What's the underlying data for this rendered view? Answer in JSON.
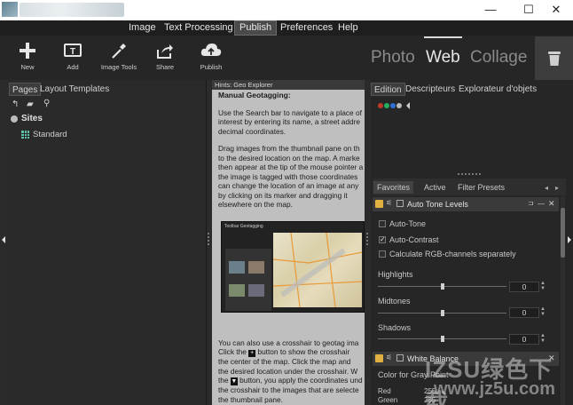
{
  "window": {
    "minimize_glyph": "—",
    "maximize_glyph": "☐",
    "close_glyph": "✕"
  },
  "menu": {
    "items": [
      "Image",
      "Text Processing",
      "Publish",
      "Preferences",
      "Help"
    ],
    "active": "Publish"
  },
  "toolbar": {
    "tools": [
      {
        "label": "New",
        "icon": "plus-icon"
      },
      {
        "label": "Add",
        "icon": "add-text-icon"
      },
      {
        "label": "Image Tools",
        "icon": "pipette-icon"
      },
      {
        "label": "Share",
        "icon": "share-icon"
      },
      {
        "label": "Publish",
        "icon": "cloud-upload-icon"
      }
    ],
    "modes": [
      "Photo",
      "Web",
      "Collage"
    ],
    "active_mode": "Web"
  },
  "left_panel": {
    "tabs": [
      "Pages",
      "Layout Templates"
    ],
    "active_tab": "Pages",
    "tree": {
      "root": "Sites",
      "child": "Standard"
    }
  },
  "hints": {
    "title": "Hints: Geo Explorer",
    "heading": "Manual Geotagging:",
    "para1": [
      "Use the Search bar to navigate to a place of",
      "interest by entering its name, a street addre",
      "decimal coordinates."
    ],
    "para2": [
      "Drag images from the thumbnail pane on th",
      "to the desired location on the map. A marke",
      "then appear at the tip of the mouse pointer a",
      "the image is tagged with those coordinates",
      "can change the location of an image at any",
      "by clicking on its marker and dragging it",
      "elsewhere on the map."
    ],
    "para3": [
      "You can also use a crosshair to geotag ima",
      "Click the",
      "button to show the crosshair",
      "the center of the map. Click the map and",
      "the desired location under the crosshair. W",
      "the",
      "button, you apply the coordinates und",
      "the crosshair to the images that are selecte",
      "the thumbnail pane."
    ],
    "screenshot_title": "Toolbar Geotagging"
  },
  "right_panel": {
    "tabs": [
      "Edition",
      "Descripteurs",
      "Explorateur d'objets"
    ],
    "active_tab": "Edition",
    "ball_colors": [
      "#c0392b",
      "#27ae60",
      "#2f6fd6",
      "#bbbbbb"
    ],
    "subtabs": [
      "Favorites",
      "Active",
      "Filter Presets"
    ],
    "active_subtab": "Favorites",
    "auto_tone": {
      "title": "Auto Tone Levels",
      "checks": [
        {
          "label": "Auto-Tone",
          "checked": false
        },
        {
          "label": "Auto-Contrast",
          "checked": true
        },
        {
          "label": "Calculate RGB-channels separately",
          "checked": false
        }
      ],
      "sliders": [
        {
          "label": "Highlights",
          "value": "0"
        },
        {
          "label": "Midtones",
          "value": "0"
        },
        {
          "label": "Shadows",
          "value": "0"
        }
      ]
    },
    "white_balance": {
      "title": "White Balance",
      "color_label": "Color for Gray Point",
      "red_label": "Red",
      "red_value": "255",
      "green_label": "Green",
      "green_value": "255"
    }
  },
  "watermark": {
    "line1": "IZSU绿色下载",
    "line2": "www.jz5u.com"
  }
}
